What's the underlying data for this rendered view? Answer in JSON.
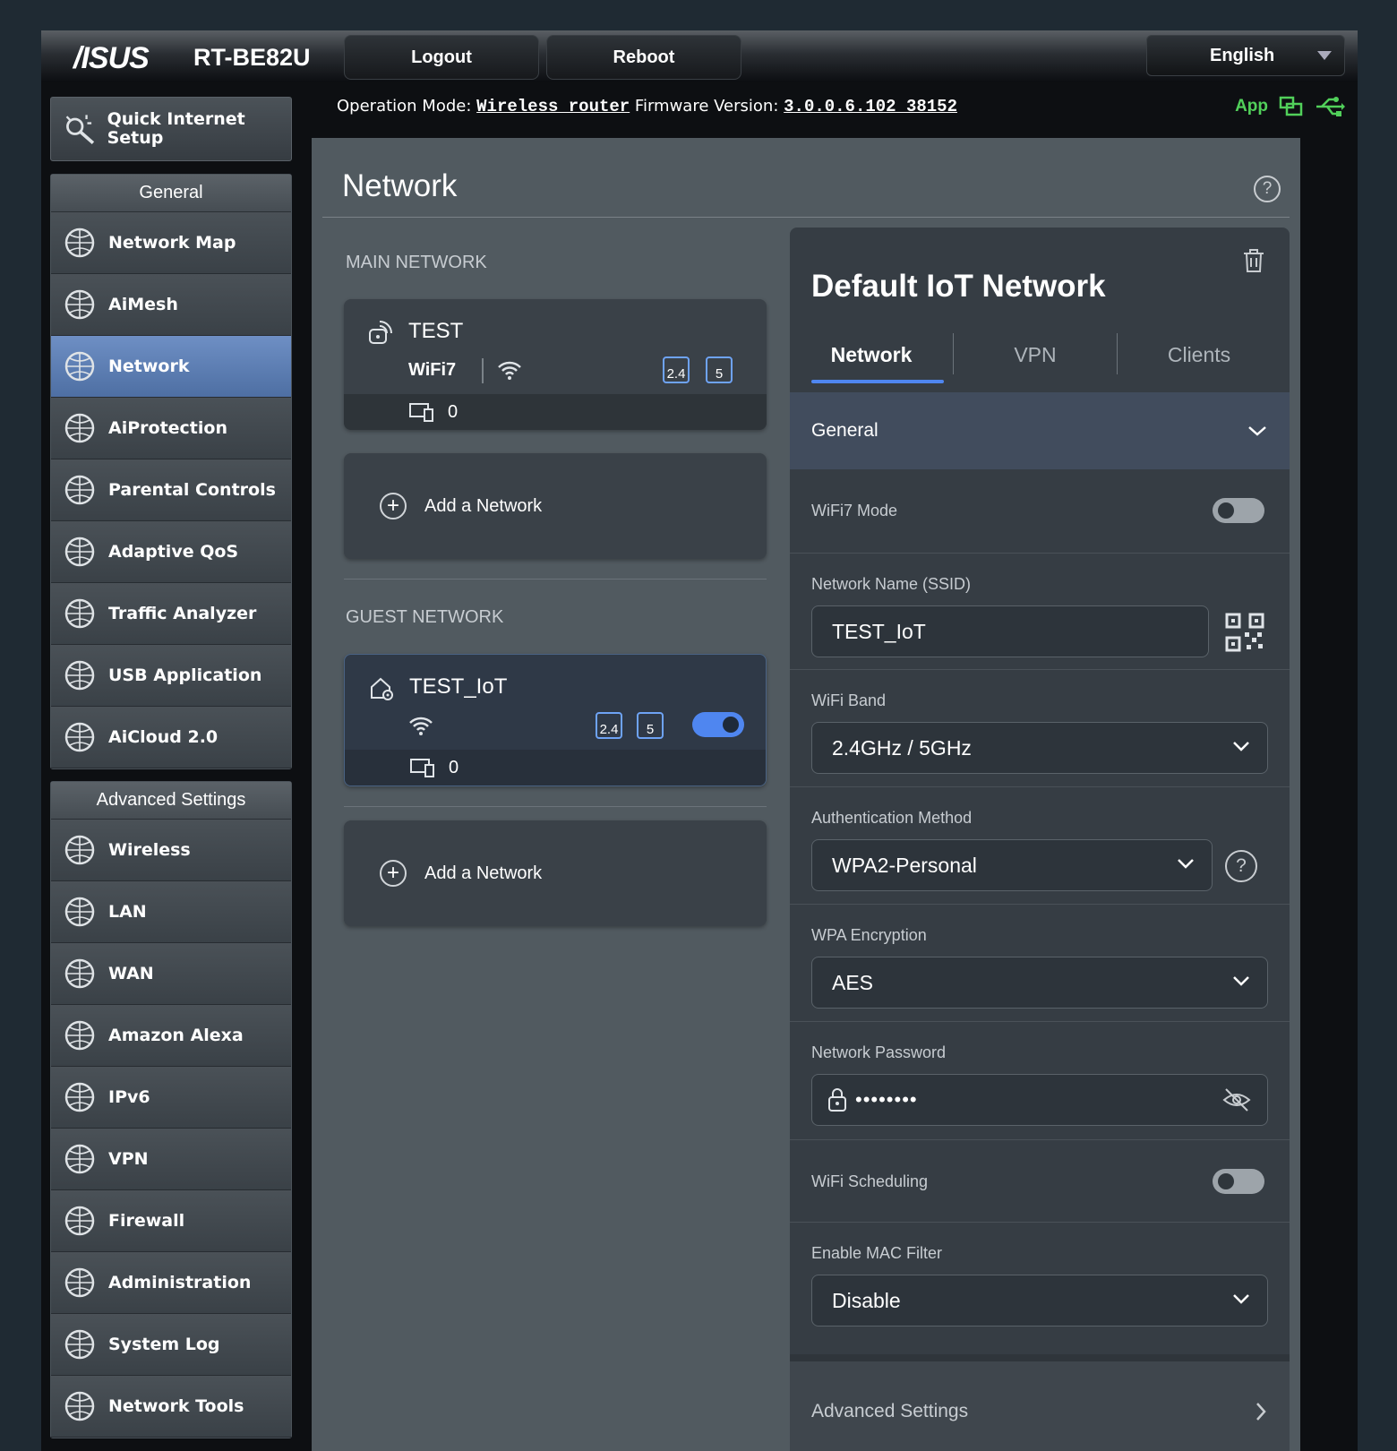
{
  "header": {
    "brand": "/ISUS",
    "model": "RT-BE82U",
    "logout_label": "Logout",
    "reboot_label": "Reboot",
    "language": "English"
  },
  "status": {
    "op_mode_label": "Operation Mode:",
    "op_mode_value": "Wireless router",
    "fw_label": "Firmware Version:",
    "fw_value": "3.0.0.6.102_38152",
    "app_label": "App"
  },
  "sidebar": {
    "qis_label": "Quick Internet Setup",
    "general_header": "General",
    "general_items": [
      {
        "label": "Network Map",
        "icon": "network-map-icon"
      },
      {
        "label": "AiMesh",
        "icon": "aimesh-icon"
      },
      {
        "label": "Network",
        "icon": "network-icon"
      },
      {
        "label": "AiProtection",
        "icon": "aiprotection-icon"
      },
      {
        "label": "Parental Controls",
        "icon": "parental-controls-icon"
      },
      {
        "label": "Adaptive QoS",
        "icon": "adaptive-qos-icon"
      },
      {
        "label": "Traffic Analyzer",
        "icon": "traffic-analyzer-icon"
      },
      {
        "label": "USB Application",
        "icon": "usb-application-icon"
      },
      {
        "label": "AiCloud 2.0",
        "icon": "aicloud-icon"
      }
    ],
    "advanced_header": "Advanced Settings",
    "advanced_items": [
      {
        "label": "Wireless",
        "icon": "wireless-icon"
      },
      {
        "label": "LAN",
        "icon": "lan-icon"
      },
      {
        "label": "WAN",
        "icon": "wan-icon"
      },
      {
        "label": "Amazon Alexa",
        "icon": "alexa-icon"
      },
      {
        "label": "IPv6",
        "icon": "ipv6-icon"
      },
      {
        "label": "VPN",
        "icon": "vpn-icon"
      },
      {
        "label": "Firewall",
        "icon": "firewall-icon"
      },
      {
        "label": "Administration",
        "icon": "administration-icon"
      },
      {
        "label": "System Log",
        "icon": "system-log-icon"
      },
      {
        "label": "Network Tools",
        "icon": "network-tools-icon"
      }
    ]
  },
  "main": {
    "title": "Network",
    "main_network_label": "MAIN NETWORK",
    "main_card": {
      "name": "TEST",
      "wifi_badge": "WiFi7",
      "band_24": "2.4",
      "band_5": "5",
      "clients": "0"
    },
    "add_network_label": "Add a Network",
    "guest_network_label": "GUEST NETWORK",
    "guest_card": {
      "name": "TEST_IoT",
      "band_24": "2.4",
      "band_5": "5",
      "clients": "0",
      "enabled": true
    }
  },
  "panel": {
    "title": "Default IoT Network",
    "tabs": [
      "Network",
      "VPN",
      "Clients"
    ],
    "general_label": "General",
    "wifi7_mode_label": "WiFi7 Mode",
    "ssid_label": "Network Name (SSID)",
    "ssid_value": "TEST_IoT",
    "band_label": "WiFi Band",
    "band_value": "2.4GHz / 5GHz",
    "auth_label": "Authentication Method",
    "auth_value": "WPA2-Personal",
    "enc_label": "WPA Encryption",
    "enc_value": "AES",
    "password_label": "Network Password",
    "password_value": "••••••••",
    "schedule_label": "WiFi Scheduling",
    "mac_label": "Enable MAC Filter",
    "mac_value": "Disable",
    "advanced_label": "Advanced Settings"
  },
  "colors": {
    "accent": "#4f86f0",
    "active_menu": "#5b7cb3",
    "app_green": "#51d05a"
  }
}
